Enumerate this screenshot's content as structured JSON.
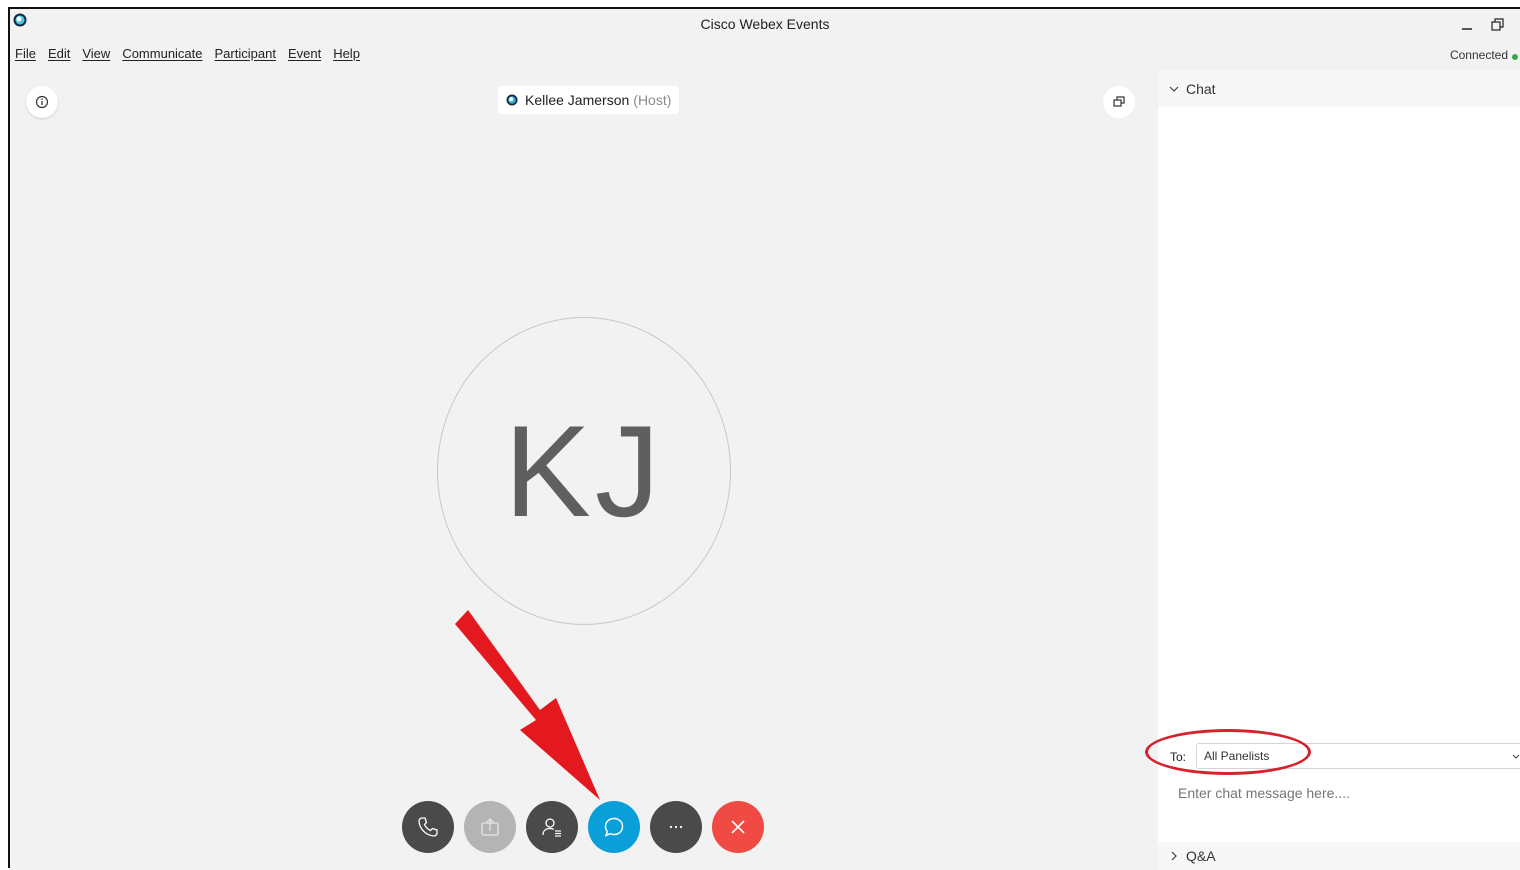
{
  "window": {
    "title": "Cisco Webex Events",
    "status": "Connected",
    "status_color": "#3ca64a"
  },
  "menu": {
    "items": [
      "File",
      "Edit",
      "View",
      "Communicate",
      "Participant",
      "Event",
      "Help"
    ]
  },
  "stage": {
    "host_name": "Kellee Jamerson",
    "host_role": "(Host)",
    "avatar_initials": "KJ",
    "controls": [
      {
        "name": "audio-button",
        "icon": "phone-icon"
      },
      {
        "name": "share-button",
        "icon": "share-icon",
        "state": "disabled"
      },
      {
        "name": "participants-button",
        "icon": "participants-icon"
      },
      {
        "name": "chat-button",
        "icon": "chat-icon",
        "state": "active"
      },
      {
        "name": "more-button",
        "icon": "more-icon"
      },
      {
        "name": "leave-button",
        "icon": "close-icon"
      }
    ]
  },
  "chat": {
    "title": "Chat",
    "to_label": "To:",
    "to_value": "All Panelists",
    "input_placeholder": "Enter chat message here...."
  },
  "qa": {
    "title": "Q&A"
  },
  "colors": {
    "accent_blue": "#0b9fd9",
    "leave_red": "#ef4a43",
    "annotation_red": "#d5222b"
  }
}
